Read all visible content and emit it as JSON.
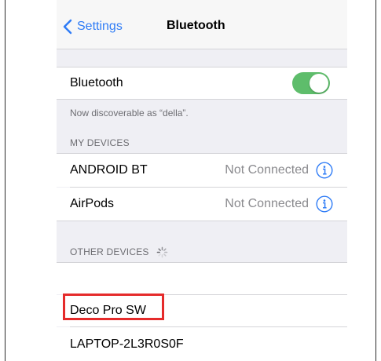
{
  "nav": {
    "back_label": "Settings",
    "title": "Bluetooth"
  },
  "bluetooth": {
    "label": "Bluetooth",
    "enabled": true,
    "toggle_color": "#5ebd6b",
    "discoverable_note": "Now discoverable as “della”."
  },
  "my_devices": {
    "header": "MY DEVICES",
    "items": [
      {
        "name": "ANDROID BT",
        "status": "Not Connected",
        "icon": "info-icon"
      },
      {
        "name": "AirPods",
        "status": "Not Connected",
        "icon": "info-icon"
      }
    ]
  },
  "other_devices": {
    "header": "OTHER DEVICES",
    "spinner_icon": "loading-spinner-icon",
    "items": [
      {
        "name": ""
      },
      {
        "name": "Deco Pro SW",
        "highlighted": true
      },
      {
        "name": "LAPTOP-2L3R0S0F"
      }
    ]
  },
  "colors": {
    "accent": "#2f7cf6",
    "highlight": "#e52b2b",
    "background": "#efeff4"
  }
}
